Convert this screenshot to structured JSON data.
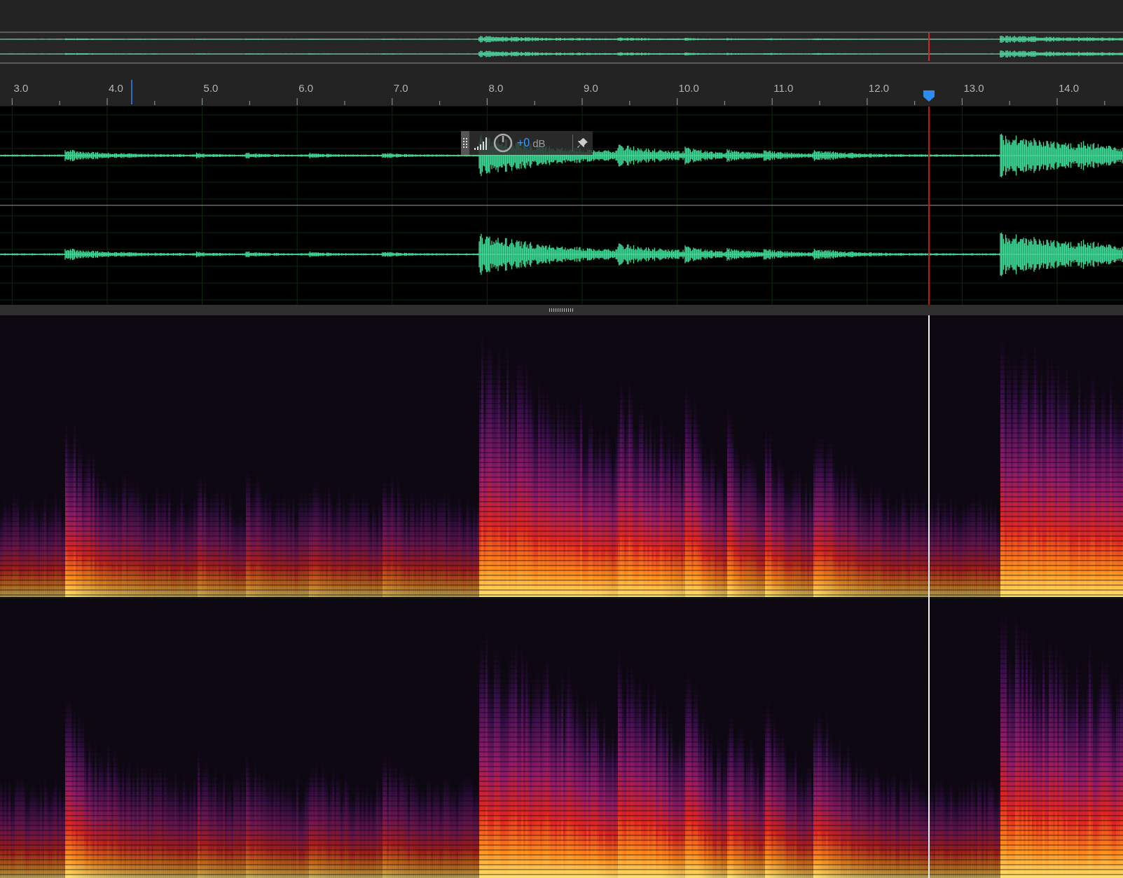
{
  "ruler": {
    "labels": [
      "3.0",
      "4.0",
      "5.0",
      "6.0",
      "7.0",
      "8.0",
      "9.0",
      "10.0",
      "11.0",
      "12.0",
      "13.0",
      "14.0"
    ]
  },
  "gain_hud": {
    "value": "+0",
    "unit": "dB"
  }
}
